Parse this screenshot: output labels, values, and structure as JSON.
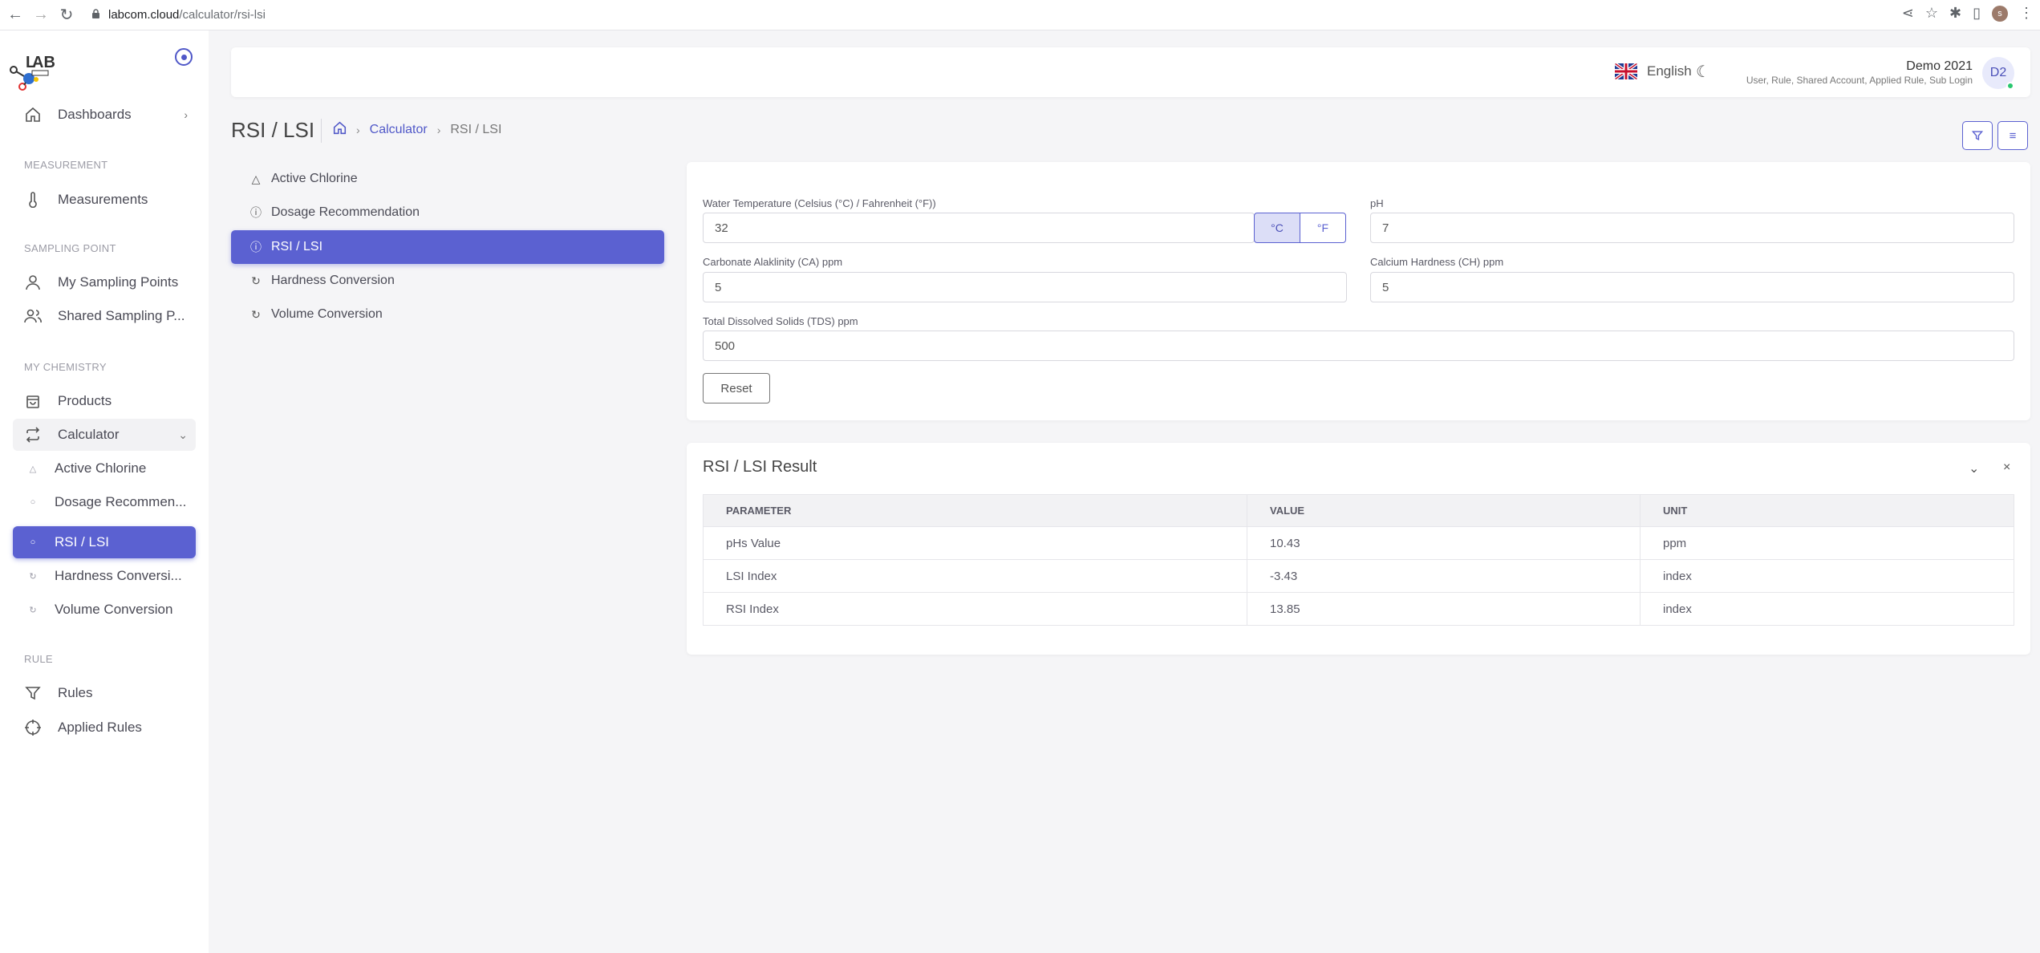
{
  "browser": {
    "url_domain": "labcom.cloud",
    "url_path": "/calculator/rsi-lsi",
    "profile_initial": "s"
  },
  "sidebar": {
    "items": [
      {
        "label": "Dashboards",
        "icon": "home-icon"
      },
      {
        "section": "MEASUREMENT"
      },
      {
        "label": "Measurements",
        "icon": "thermometer-icon"
      },
      {
        "section": "SAMPLING POINT"
      },
      {
        "label": "My Sampling Points",
        "icon": "user-icon"
      },
      {
        "label": "Shared Sampling P...",
        "icon": "users-icon"
      },
      {
        "section": "MY CHEMISTRY"
      },
      {
        "label": "Products",
        "icon": "shopping-bag-icon"
      },
      {
        "label": "Calculator",
        "icon": "repeat-icon"
      },
      {
        "label": "Active Chlorine",
        "icon": "triangle-icon"
      },
      {
        "label": "Dosage Recommen...",
        "icon": "alert-circle-icon"
      },
      {
        "label": "RSI / LSI",
        "icon": "alert-circle-icon"
      },
      {
        "label": "Hardness Conversi...",
        "icon": "refresh-icon"
      },
      {
        "label": "Volume Conversion",
        "icon": "refresh-icon"
      },
      {
        "section": "RULE"
      },
      {
        "label": "Rules",
        "icon": "filter-icon"
      },
      {
        "label": "Applied Rules",
        "icon": "target-icon"
      }
    ]
  },
  "header": {
    "language": "English",
    "user_name": "Demo 2021",
    "user_roles": "User, Rule, Shared Account, Applied Rule, Sub Login",
    "avatar_initials": "D2"
  },
  "page": {
    "title": "RSI / LSI",
    "breadcrumb_link": "Calculator",
    "breadcrumb_current": "RSI / LSI"
  },
  "calculator_menu": [
    {
      "label": "Active Chlorine",
      "icon": "triangle-icon"
    },
    {
      "label": "Dosage Recommendation",
      "icon": "alert-circle-icon"
    },
    {
      "label": "RSI / LSI",
      "icon": "alert-circle-icon",
      "active": true
    },
    {
      "label": "Hardness Conversion",
      "icon": "refresh-icon"
    },
    {
      "label": "Volume Conversion",
      "icon": "refresh-icon"
    }
  ],
  "form": {
    "water_temp_label": "Water Temperature (Celsius (°C) / Fahrenheit (°F))",
    "water_temp_value": "32",
    "unit_celsius": "°C",
    "unit_fahrenheit": "°F",
    "ph_label": "pH",
    "ph_value": "7",
    "ca_label": "Carbonate Alaklinity (CA) ppm",
    "ca_value": "5",
    "ch_label": "Calcium Hardness (CH) ppm",
    "ch_value": "5",
    "tds_label": "Total Dissolved Solids (TDS) ppm",
    "tds_value": "500",
    "reset_label": "Reset"
  },
  "result": {
    "title": "RSI / LSI Result",
    "columns": [
      "PARAMETER",
      "VALUE",
      "UNIT"
    ],
    "rows": [
      [
        "pHs Value",
        "10.43",
        "ppm"
      ],
      [
        "LSI Index",
        "-3.43",
        "index"
      ],
      [
        "RSI Index",
        "13.85",
        "index"
      ]
    ]
  },
  "colors": {
    "accent": "#5b61d1",
    "status_online": "#28c76f"
  }
}
